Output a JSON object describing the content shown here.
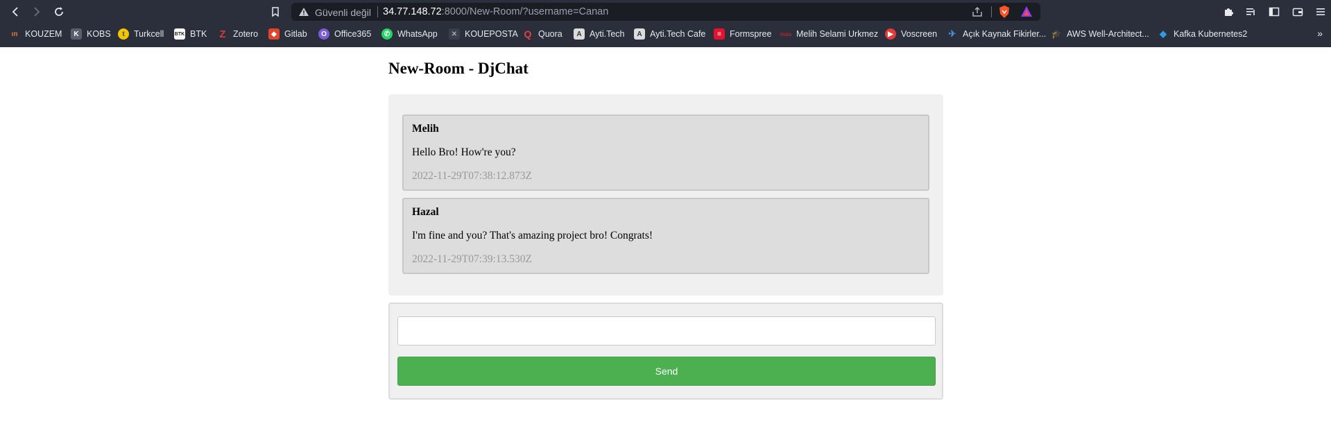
{
  "browser": {
    "security_text": "Güvenli değil",
    "url_host": "34.77.148.72",
    "url_rest": ":8000/New-Room/?username=Canan"
  },
  "bookmarks": [
    {
      "label": "KOUZEM",
      "icon": "kouzem-icon",
      "color": "#e8772e"
    },
    {
      "label": "KOBS",
      "icon": "kobs-icon",
      "color": "#7a7f8c"
    },
    {
      "label": "Turkcell",
      "icon": "turkcell-icon",
      "color": "#f5c400"
    },
    {
      "label": "BTK",
      "icon": "btk-icon",
      "color": "#ffffff"
    },
    {
      "label": "Zotero",
      "icon": "zotero-icon",
      "color": "#d63b3b"
    },
    {
      "label": "Gitlab",
      "icon": "gitlab-icon",
      "color": "#e2432a"
    },
    {
      "label": "Office365",
      "icon": "office365-icon",
      "color": "#7b5cd6"
    },
    {
      "label": "WhatsApp",
      "icon": "whatsapp-icon",
      "color": "#25d366"
    },
    {
      "label": "KOUEPOSTA",
      "icon": "kouposta-icon",
      "color": "#3a3f4c"
    },
    {
      "label": "Quora",
      "icon": "quora-icon",
      "color": "#b92b27"
    },
    {
      "label": "Ayti.Tech",
      "icon": "aytitech-icon",
      "color": "#dcdcdc"
    },
    {
      "label": "Ayti.Tech Cafe",
      "icon": "aytitech-cafe-icon",
      "color": "#dcdcdc"
    },
    {
      "label": "Formspree",
      "icon": "formspree-icon",
      "color": "#e5122e"
    },
    {
      "label": "Melih Selami Urkmez",
      "icon": "msu-icon",
      "color": "#c0212c"
    },
    {
      "label": "Voscreen",
      "icon": "voscreen-icon",
      "color": "#e53935"
    },
    {
      "label": "Açık Kaynak Fikirler...",
      "icon": "acik-kaynak-icon",
      "color": "#4a90d9"
    },
    {
      "label": "AWS Well-Architect...",
      "icon": "aws-icon",
      "color": "#111111"
    },
    {
      "label": "Kafka Kubernetes2",
      "icon": "kafka-icon",
      "color": "#2f9be4"
    }
  ],
  "page": {
    "title": "New-Room - DjChat"
  },
  "messages": [
    {
      "user": "Melih",
      "text": "Hello Bro! How're you?",
      "time": "2022-11-29T07:38:12.873Z"
    },
    {
      "user": "Hazal",
      "text": "I'm fine and you? That's amazing project bro! Congrats!",
      "time": "2022-11-29T07:39:13.530Z"
    }
  ],
  "form": {
    "input_value": "",
    "send_label": "Send"
  },
  "colors": {
    "send_button": "#4caf50",
    "chrome_bg": "#2b2f3c"
  }
}
